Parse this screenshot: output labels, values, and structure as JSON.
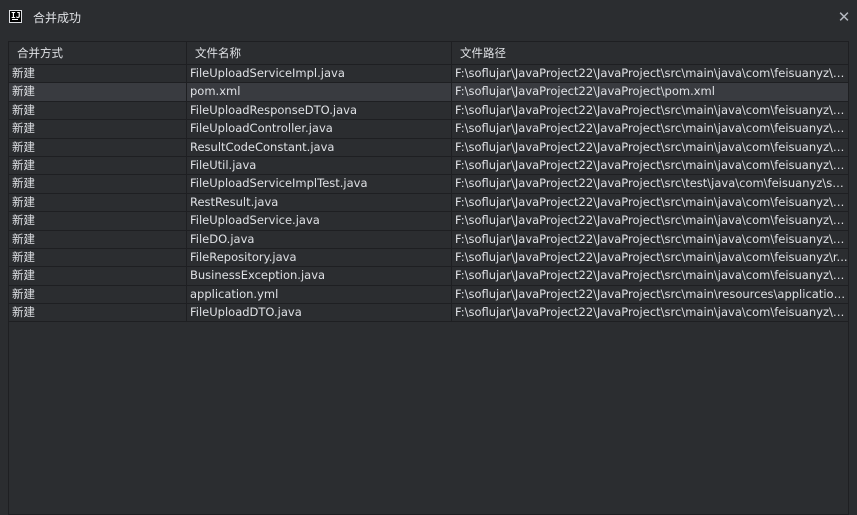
{
  "window": {
    "title": "合并成功",
    "app_icon": "intellij-icon",
    "close_icon": "close-icon",
    "close_glyph": "✕"
  },
  "table": {
    "columns": [
      "合并方式",
      "文件名称",
      "文件路径"
    ],
    "selected_row": 1,
    "rows": [
      {
        "type": "新建",
        "name": "FileUploadServiceImpl.java",
        "path": "F:\\soflujar\\JavaProject22\\JavaProject\\src\\main\\java\\com\\feisuanyz\\s..."
      },
      {
        "type": "新建",
        "name": "pom.xml",
        "path": "F:\\soflujar\\JavaProject22\\JavaProject\\pom.xml"
      },
      {
        "type": "新建",
        "name": "FileUploadResponseDTO.java",
        "path": "F:\\soflujar\\JavaProject22\\JavaProject\\src\\main\\java\\com\\feisuanyz\\d..."
      },
      {
        "type": "新建",
        "name": "FileUploadController.java",
        "path": "F:\\soflujar\\JavaProject22\\JavaProject\\src\\main\\java\\com\\feisuanyz\\c..."
      },
      {
        "type": "新建",
        "name": "ResultCodeConstant.java",
        "path": "F:\\soflujar\\JavaProject22\\JavaProject\\src\\main\\java\\com\\feisuanyz\\u..."
      },
      {
        "type": "新建",
        "name": "FileUtil.java",
        "path": "F:\\soflujar\\JavaProject22\\JavaProject\\src\\main\\java\\com\\feisuanyz\\u..."
      },
      {
        "type": "新建",
        "name": "FileUploadServiceImplTest.java",
        "path": "F:\\soflujar\\JavaProject22\\JavaProject\\src\\test\\java\\com\\feisuanyz\\se..."
      },
      {
        "type": "新建",
        "name": "RestResult.java",
        "path": "F:\\soflujar\\JavaProject22\\JavaProject\\src\\main\\java\\com\\feisuanyz\\u..."
      },
      {
        "type": "新建",
        "name": "FileUploadService.java",
        "path": "F:\\soflujar\\JavaProject22\\JavaProject\\src\\main\\java\\com\\feisuanyz\\s..."
      },
      {
        "type": "新建",
        "name": "FileDO.java",
        "path": "F:\\soflujar\\JavaProject22\\JavaProject\\src\\main\\java\\com\\feisuanyz\\e..."
      },
      {
        "type": "新建",
        "name": "FileRepository.java",
        "path": "F:\\soflujar\\JavaProject22\\JavaProject\\src\\main\\java\\com\\feisuanyz\\r..."
      },
      {
        "type": "新建",
        "name": "BusinessException.java",
        "path": "F:\\soflujar\\JavaProject22\\JavaProject\\src\\main\\java\\com\\feisuanyz\\e..."
      },
      {
        "type": "新建",
        "name": "application.yml",
        "path": "F:\\soflujar\\JavaProject22\\JavaProject\\src\\main\\resources\\application..."
      },
      {
        "type": "新建",
        "name": "FileUploadDTO.java",
        "path": "F:\\soflujar\\JavaProject22\\JavaProject\\src\\main\\java\\com\\feisuanyz\\d..."
      }
    ]
  }
}
